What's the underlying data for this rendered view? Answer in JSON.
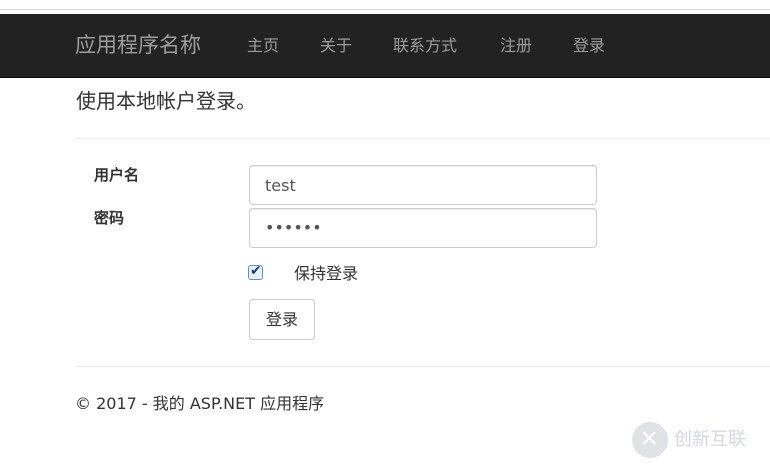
{
  "navbar": {
    "brand": "应用程序名称",
    "items": [
      {
        "label": "主页"
      },
      {
        "label": "关于"
      },
      {
        "label": "联系方式"
      },
      {
        "label": "注册"
      },
      {
        "label": "登录"
      }
    ],
    "background": "#222222",
    "text_color": "#9d9d9d"
  },
  "login": {
    "heading": "使用本地帐户登录。",
    "username_label": "用户名",
    "username_value": "test",
    "password_label": "密码",
    "password_value": "••••••",
    "remember_label": "保持登录",
    "remember_checked": true,
    "submit_label": "登录"
  },
  "footer": {
    "text": "© 2017 - 我的 ASP.NET 应用程序"
  },
  "watermark": {
    "text": "创新互联",
    "icon": "cross-logo-icon"
  }
}
